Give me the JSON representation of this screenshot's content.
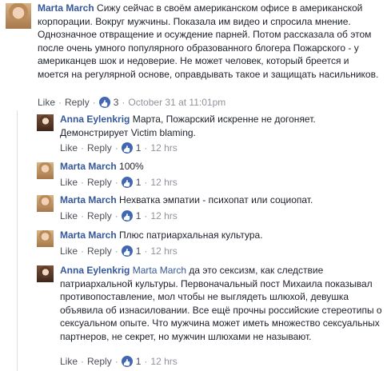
{
  "actions": {
    "like": "Like",
    "reply": "Reply",
    "sep": "·"
  },
  "comments": [
    {
      "author": "Marta March",
      "mention": "",
      "text": "Сижу сейчас в своём американском офисе в американской корпорации. Вокруг мужчины. Показала им видео и спросила мнение. Однозначное отвращение и осуждение парней. Потом рассказала об этом после очень умного популярного образованного блогера Пожарского - у американцев шок и недоверие. Не может человек, который бреется и моется на регулярной основе, оправдывать такое и защищать насильников.",
      "likes": "3",
      "time": "October 31 at 11:01pm"
    },
    {
      "author": "Anna Eylenkrig",
      "mention": "",
      "text": "Марта, Пожарский искренне не догоняет. Демонстрирует Victim blaming.",
      "likes": "1",
      "time": "12 hrs"
    },
    {
      "author": "Marta March",
      "mention": "",
      "text": "100%",
      "likes": "1",
      "time": "12 hrs"
    },
    {
      "author": "Marta March",
      "mention": "",
      "text": "Нехватка эмпатии - психопат или социопат.",
      "likes": "1",
      "time": "12 hrs"
    },
    {
      "author": "Marta March",
      "mention": "",
      "text": "Плюс патриархальная культура.",
      "likes": "1",
      "time": "12 hrs"
    },
    {
      "author": "Anna Eylenkrig",
      "mention": "Marta March",
      "text": "да это сексизм, как следствие патриархальной культуры. Первоначальный пост Михаила показывал противопоставление, мол чтобы не выглядеть шлюхой, девушка объявила об изнасиловании. Все ещё прочны российские стереотипы о сексуальном опыте. Что мужчина может иметь множество сексуальных партнеров, не секрет, но мужчин шлюхами не называют.",
      "likes": "1",
      "time": "12 hrs"
    }
  ]
}
